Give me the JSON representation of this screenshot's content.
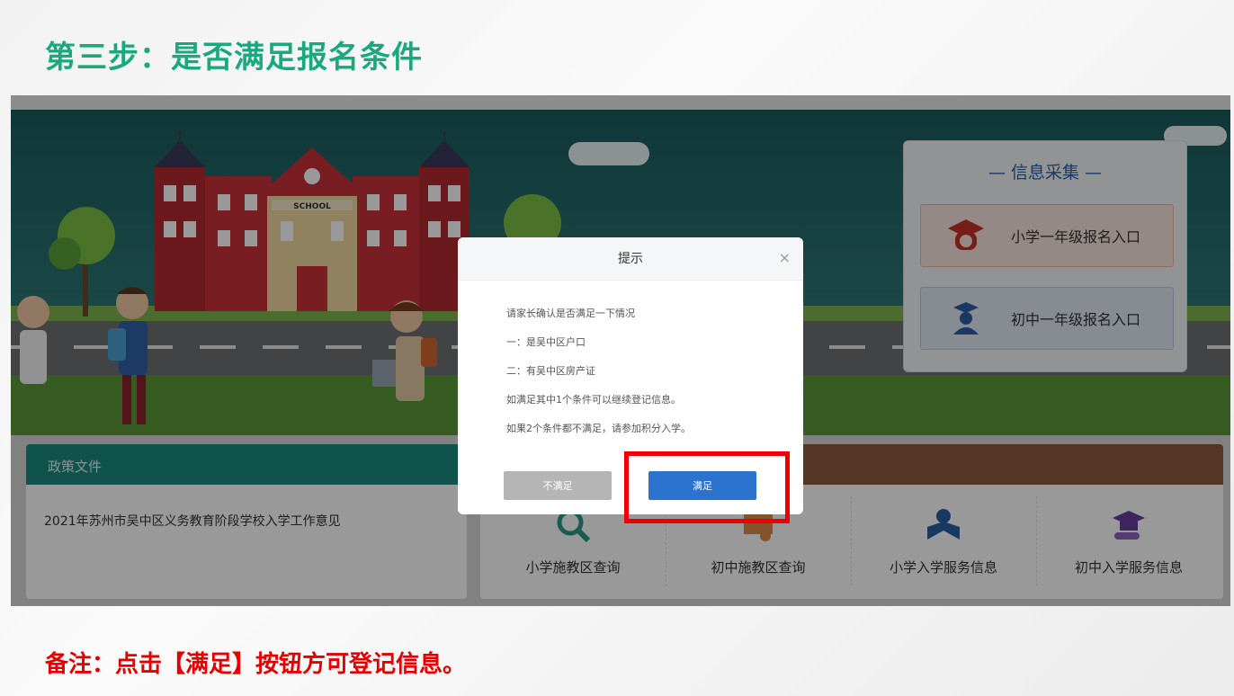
{
  "slide": {
    "title": "第三步：是否满足报名条件",
    "note": "备注：点击【满足】按钮方可登记信息。"
  },
  "hero": {
    "school_sign": "SCHOOL"
  },
  "info_panel": {
    "title": "— 信息采集 —",
    "entries": [
      {
        "label": "小学一年级报名入口",
        "icon": "graduate-icon"
      },
      {
        "label": "初中一年级报名入口",
        "icon": "bachelor-icon"
      }
    ]
  },
  "policy": {
    "header": "政策文件",
    "items": [
      "2021年苏州市吴中区义务教育阶段学校入学工作意见"
    ]
  },
  "services": {
    "items": [
      {
        "label": "小学施教区查询",
        "icon": "search-icon"
      },
      {
        "label": "初中施教区查询",
        "icon": "certificate-icon"
      },
      {
        "label": "小学入学服务信息",
        "icon": "reader-icon"
      },
      {
        "label": "初中入学服务信息",
        "icon": "mortarboard-icon"
      }
    ]
  },
  "dialog": {
    "title": "提示",
    "close": "×",
    "lines": [
      "请家长确认是否满足一下情况",
      "一：是吴中区户口",
      "二：有吴中区房产证",
      "如满足其中1个条件可以继续登记信息。",
      "如果2个条件都不满足，请参加积分入学。"
    ],
    "cancel_label": "不满足",
    "confirm_label": "满足"
  },
  "colors": {
    "title_green": "#1aa97c",
    "note_red": "#e60000",
    "primary_blue": "#2b73cf",
    "highlight_red": "#ee0000"
  }
}
